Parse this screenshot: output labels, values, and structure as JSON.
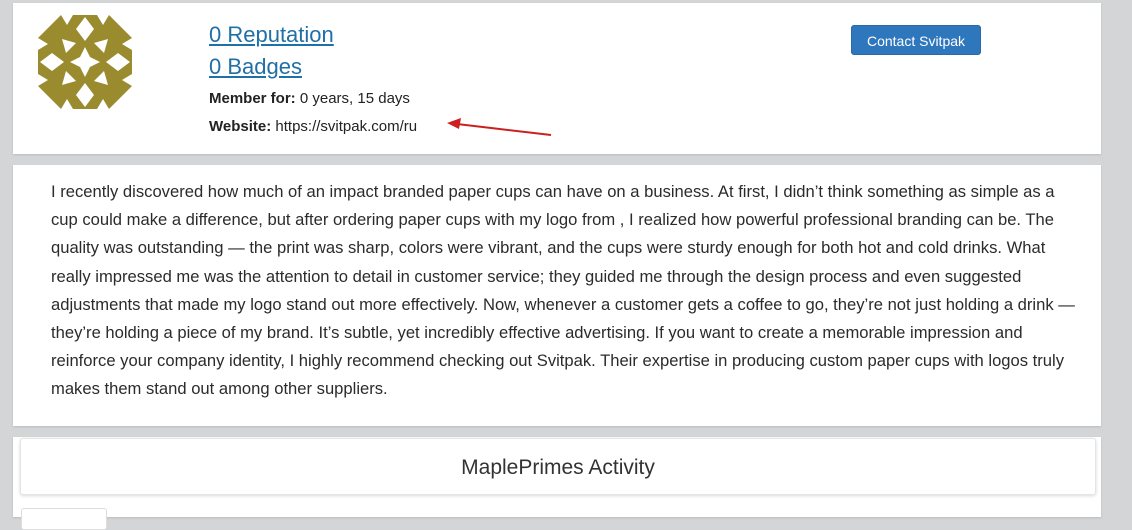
{
  "profile": {
    "reputation": "0 Reputation",
    "badges": "0 Badges",
    "member_for_label": "Member for:",
    "member_for_value": "0 years, 15 days",
    "website_label": "Website:",
    "website_value": "https://svitpak.com/ru",
    "contact_button": "Contact Svitpak",
    "avatar_color": "#9a8b2f",
    "link_color": "#1f6fa8",
    "button_color": "#2f77bd",
    "annotation_arrow_color": "#cc1f1f"
  },
  "bio": {
    "text": "I recently discovered how much of an impact branded paper cups can have on a business. At first, I didn’t think something as simple as a cup could make a difference, but after ordering paper cups with my logo from , I realized how powerful professional branding can be. The quality was outstanding — the print was sharp, colors were vibrant, and the cups were sturdy enough for both hot and cold drinks. What really impressed me was the attention to detail in customer service; they guided me through the design process and even suggested adjustments that made my logo stand out more effectively. Now, whenever a customer gets a coffee to go, they’re not just holding a drink — they’re holding a piece of my brand. It’s subtle, yet incredibly effective advertising. If you want to create a memorable impression and reinforce your company identity, I highly recommend checking out Svitpak. Their expertise in producing custom paper cups with logos truly makes them stand out among other suppliers."
  },
  "activity": {
    "title": "MaplePrimes Activity"
  }
}
